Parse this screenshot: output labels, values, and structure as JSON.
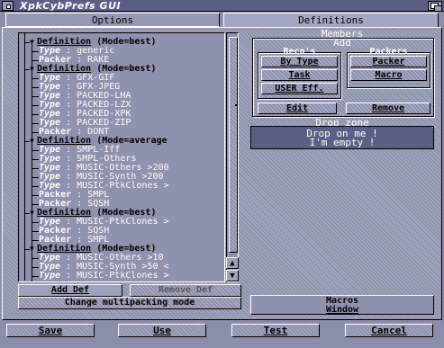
{
  "window": {
    "title": "XpkCybPrefs GUI"
  },
  "tabs": {
    "options": "Options",
    "definitions": "Definitions"
  },
  "tree": {
    "rows": [
      {
        "kind": "def",
        "label": "Definition",
        "value": " (Mode=best)",
        "depth": 1
      },
      {
        "kind": "type",
        "label": "Type",
        "value": " : generic",
        "depth": 2
      },
      {
        "kind": "pk",
        "label": "Packer",
        "value": " : RAKE",
        "depth": 2
      },
      {
        "kind": "def",
        "label": "Definition",
        "value": " (Mode=best)",
        "depth": 1
      },
      {
        "kind": "type",
        "label": "Type",
        "value": " : GFX-GIF",
        "depth": 2
      },
      {
        "kind": "type",
        "label": "Type",
        "value": " : GFX-JPEG",
        "depth": 2
      },
      {
        "kind": "type",
        "label": "Type",
        "value": " : PACKED-LHA",
        "depth": 2
      },
      {
        "kind": "type",
        "label": "Type",
        "value": " : PACKED-LZX",
        "depth": 2
      },
      {
        "kind": "type",
        "label": "Type",
        "value": " : PACKED-XPK",
        "depth": 2
      },
      {
        "kind": "type",
        "label": "Type",
        "value": " : PACKED-ZIP",
        "depth": 2
      },
      {
        "kind": "pk",
        "label": "Packer",
        "value": " : DONT",
        "depth": 2
      },
      {
        "kind": "def",
        "label": "Definition",
        "value": " (Mode=average",
        "depth": 1
      },
      {
        "kind": "type",
        "label": "Type",
        "value": " : SMPL-Iff",
        "depth": 2
      },
      {
        "kind": "type",
        "label": "Type",
        "value": " : SMPL-Others",
        "depth": 2
      },
      {
        "kind": "type",
        "label": "Type",
        "value": " : MUSIC-Others >200",
        "depth": 2
      },
      {
        "kind": "type",
        "label": "Type",
        "value": " : MUSIC-Synth >200",
        "depth": 2
      },
      {
        "kind": "type",
        "label": "Type",
        "value": " : MUSIC-PtkClones >",
        "depth": 2
      },
      {
        "kind": "pk",
        "label": "Packer",
        "value": " : SMPL",
        "depth": 2
      },
      {
        "kind": "pk",
        "label": "Packer",
        "value": " : SQSH",
        "depth": 2
      },
      {
        "kind": "def",
        "label": "Definition",
        "value": " (Mode=best)",
        "depth": 1
      },
      {
        "kind": "type",
        "label": "Type",
        "value": " : MUSIC-PtkClones >",
        "depth": 2
      },
      {
        "kind": "pk",
        "label": "Packer",
        "value": " : SQSH",
        "depth": 2
      },
      {
        "kind": "pk",
        "label": "Packer",
        "value": " : SMPL",
        "depth": 2
      },
      {
        "kind": "def",
        "label": "Definition",
        "value": " (Mode=best)",
        "depth": 1
      },
      {
        "kind": "type",
        "label": "Type",
        "value": " : MUSIC-Others >10",
        "depth": 2
      },
      {
        "kind": "type",
        "label": "Type",
        "value": " : MUSIC-Synth >50 <",
        "depth": 2
      },
      {
        "kind": "type",
        "label": "Type",
        "value": " : MUSIC-PtkClones >",
        "depth": 2
      }
    ]
  },
  "scroll": {
    "up": "▲",
    "down": "▼"
  },
  "buttons": {
    "add_def": "Add Def",
    "remove_def": "Remove Def",
    "multipack": "Change multipacking mode",
    "save": "Save",
    "use": "Use",
    "test": "Test",
    "cancel": "Cancel"
  },
  "members": {
    "title": "Members",
    "add_title": "Add",
    "recos_title": "Reco's",
    "packers_title": "Packers",
    "by_type": "By Type",
    "task": "Task",
    "user_eff": "USER Eff.",
    "packer": "Packer",
    "macro": "Macro",
    "edit": "Edit",
    "remove": "Remove"
  },
  "dropzone": {
    "label": "Drop zone",
    "line1": "Drop on me !",
    "line2": "I'm empty !"
  },
  "macros": {
    "line1": "Macros",
    "line2": "Window"
  }
}
